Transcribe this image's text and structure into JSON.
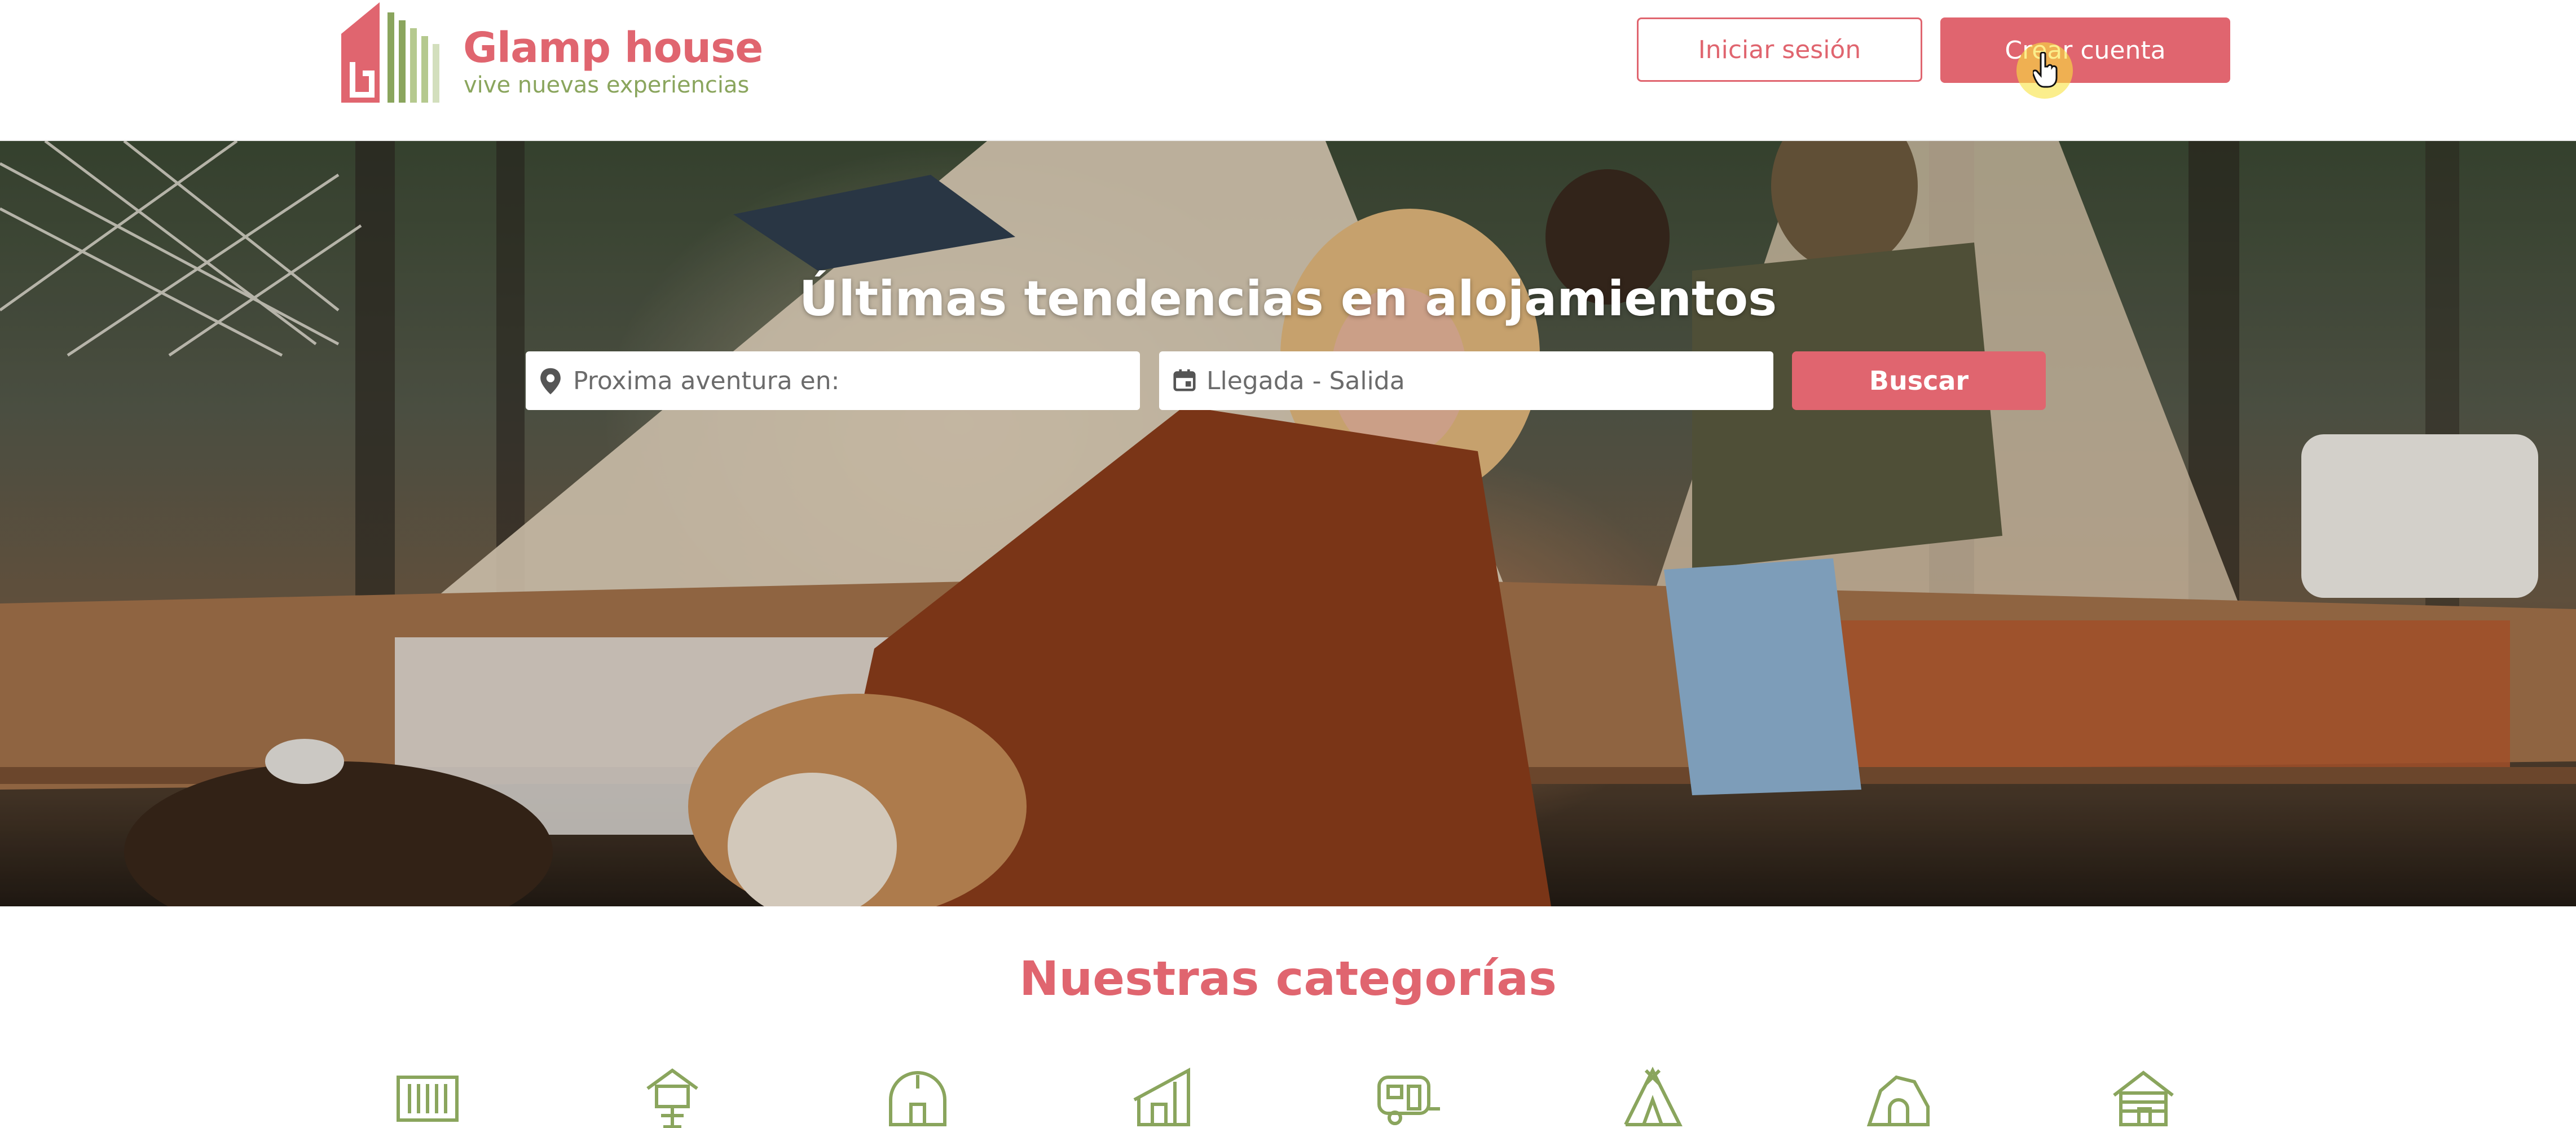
{
  "header": {
    "logo": {
      "title": "Glamp house",
      "tagline": "vive nuevas experiencias"
    },
    "login_label": "Iniciar sesión",
    "create_account_label": "Crear cuenta"
  },
  "hero": {
    "title": "Últimas tendencias en alojamientos",
    "destination_placeholder": "Proxima aventura en:",
    "dates_placeholder": "Llegada - Salida",
    "search_label": "Buscar"
  },
  "categories": {
    "title": "Nuestras categorías",
    "icons": [
      "container-icon",
      "treehouse-icon",
      "dome-icon",
      "cabin-icon",
      "caravan-icon",
      "teepee-icon",
      "cave-icon",
      "log-cabin-icon"
    ]
  },
  "colors": {
    "brand_pink": "#e0656f",
    "brand_green": "#8aa55d",
    "cursor_highlight": "#f8e240"
  }
}
